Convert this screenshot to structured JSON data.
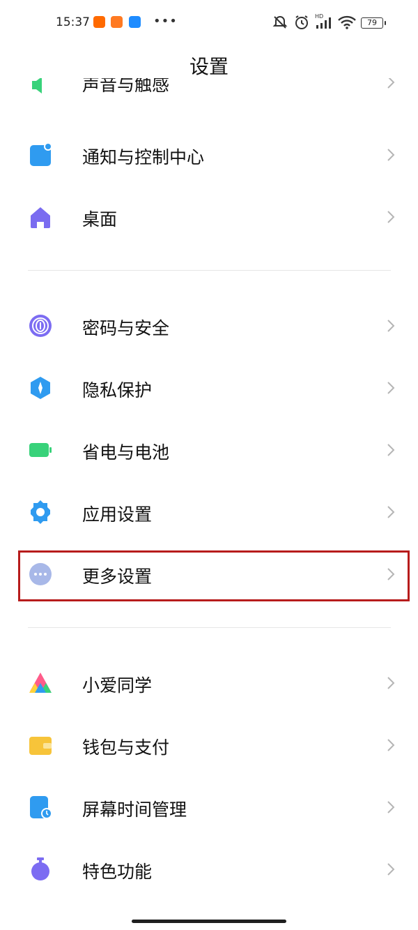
{
  "status_bar": {
    "time": "15:37",
    "battery_level": "79",
    "hd_label": "HD",
    "app_icons": [
      "mi-app-icon",
      "store-app-icon",
      "dingtalk-app-icon"
    ],
    "right_icons": [
      "mute-icon",
      "alarm-icon",
      "signal-icon",
      "wifi-icon",
      "battery-icon"
    ]
  },
  "header": {
    "title": "设置"
  },
  "partial_item": {
    "label": "声音与触感",
    "icon": "sound-icon"
  },
  "groups": [
    {
      "items": [
        {
          "label": "通知与控制中心",
          "icon": "notification-icon",
          "color": "#2f9bf0"
        },
        {
          "label": "桌面",
          "icon": "home-icon",
          "color": "#7a6cf0"
        }
      ]
    },
    {
      "items": [
        {
          "label": "密码与安全",
          "icon": "fingerprint-icon",
          "color": "#7c6cf2"
        },
        {
          "label": "隐私保护",
          "icon": "privacy-shield-icon",
          "color": "#2f9bf0"
        },
        {
          "label": "省电与电池",
          "icon": "battery-saver-icon",
          "color": "#38d27a"
        },
        {
          "label": "应用设置",
          "icon": "gear-icon",
          "color": "#2f9bf0"
        },
        {
          "label": "更多设置",
          "icon": "more-icon",
          "color": "#a8b8e8",
          "highlighted": true
        }
      ]
    },
    {
      "items": [
        {
          "label": "小爱同学",
          "icon": "xiaoai-icon",
          "color": "#ff5c8a"
        },
        {
          "label": "钱包与支付",
          "icon": "wallet-icon",
          "color": "#f7c43a"
        },
        {
          "label": "屏幕时间管理",
          "icon": "screen-time-icon",
          "color": "#2f9bf0"
        },
        {
          "label": "特色功能",
          "icon": "features-icon",
          "color": "#7c6cf2"
        }
      ]
    }
  ],
  "highlight_color": "#b71c1c"
}
